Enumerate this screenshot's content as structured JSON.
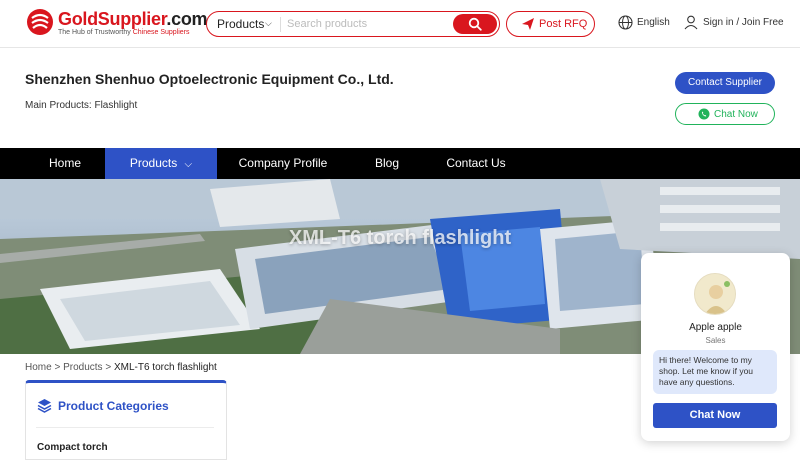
{
  "header": {
    "logo": {
      "brand_main": "GoldSupplier",
      "brand_suffix": ".com",
      "tagline_prefix": "The Hub of Trustworthy ",
      "tagline_accent": "Chinese Suppliers"
    },
    "search": {
      "category": "Products",
      "placeholder": "Search products",
      "value": ""
    },
    "rfq_label": "Post RFQ",
    "language": "English",
    "signin_label": "Sign in / Join Free"
  },
  "company": {
    "name": "Shenzhen Shenhuo Optoelectronic Equipment Co., Ltd.",
    "main_products": "Main Products: Flashlight",
    "contact_label": "Contact Supplier",
    "chat_label": "Chat Now"
  },
  "nav": {
    "items": [
      {
        "label": "Home"
      },
      {
        "label": "Products"
      },
      {
        "label": "Company Profile"
      },
      {
        "label": "Blog"
      },
      {
        "label": "Contact Us"
      }
    ],
    "active": "Products"
  },
  "banner": {
    "title": "XML-T6 torch flashlight"
  },
  "breadcrumb": {
    "home": "Home",
    "sep1": " > ",
    "products": "Products",
    "sep2": " > ",
    "current": "XML-T6 torch flashlight"
  },
  "categories": {
    "title": "Product Categories",
    "items": [
      {
        "label": "Compact torch"
      }
    ]
  },
  "chat_widget": {
    "agent_name": "Apple apple",
    "agent_role": "Sales",
    "message": "Hi there! Welcome to my shop. Let me know if you have any questions.",
    "button_label": "Chat Now"
  },
  "colors": {
    "brand_red": "#d9161e",
    "accent_blue": "#2e52c6",
    "whatsapp_green": "#21b35b",
    "nav_bg": "#000000"
  },
  "icons": [
    "logo-mark-icon",
    "search-icon",
    "paper-plane-icon",
    "globe-icon",
    "user-icon",
    "whatsapp-icon",
    "chevron-down-icon",
    "layers-icon"
  ]
}
